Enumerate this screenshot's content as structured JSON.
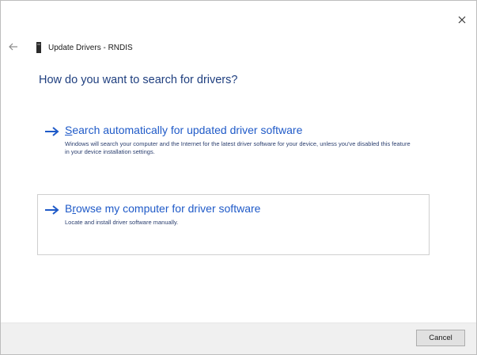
{
  "window": {
    "title": "Update Drivers - RNDIS",
    "close_icon": "close-icon",
    "back_icon": "back-arrow-icon",
    "device_icon": "device-icon"
  },
  "main": {
    "heading": "How do you want to search for drivers?",
    "options": [
      {
        "title_prefix": "",
        "title_accel": "S",
        "title_rest": "earch automatically for updated driver software",
        "description": "Windows will search your computer and the Internet for the latest driver software for your device, unless you've disabled this feature in your device installation settings.",
        "icon": "arrow-right-icon"
      },
      {
        "title_prefix": "B",
        "title_accel": "r",
        "title_rest": "owse my computer for driver software",
        "description": "Locate and install driver software manually.",
        "icon": "arrow-right-icon"
      }
    ]
  },
  "footer": {
    "cancel_label": "Cancel"
  },
  "colors": {
    "heading": "#1f3f7f",
    "link": "#1f5ac8",
    "description": "#2b3f6f",
    "footer_bg": "#f0f0f0",
    "option_border": "#cfcfcf"
  }
}
